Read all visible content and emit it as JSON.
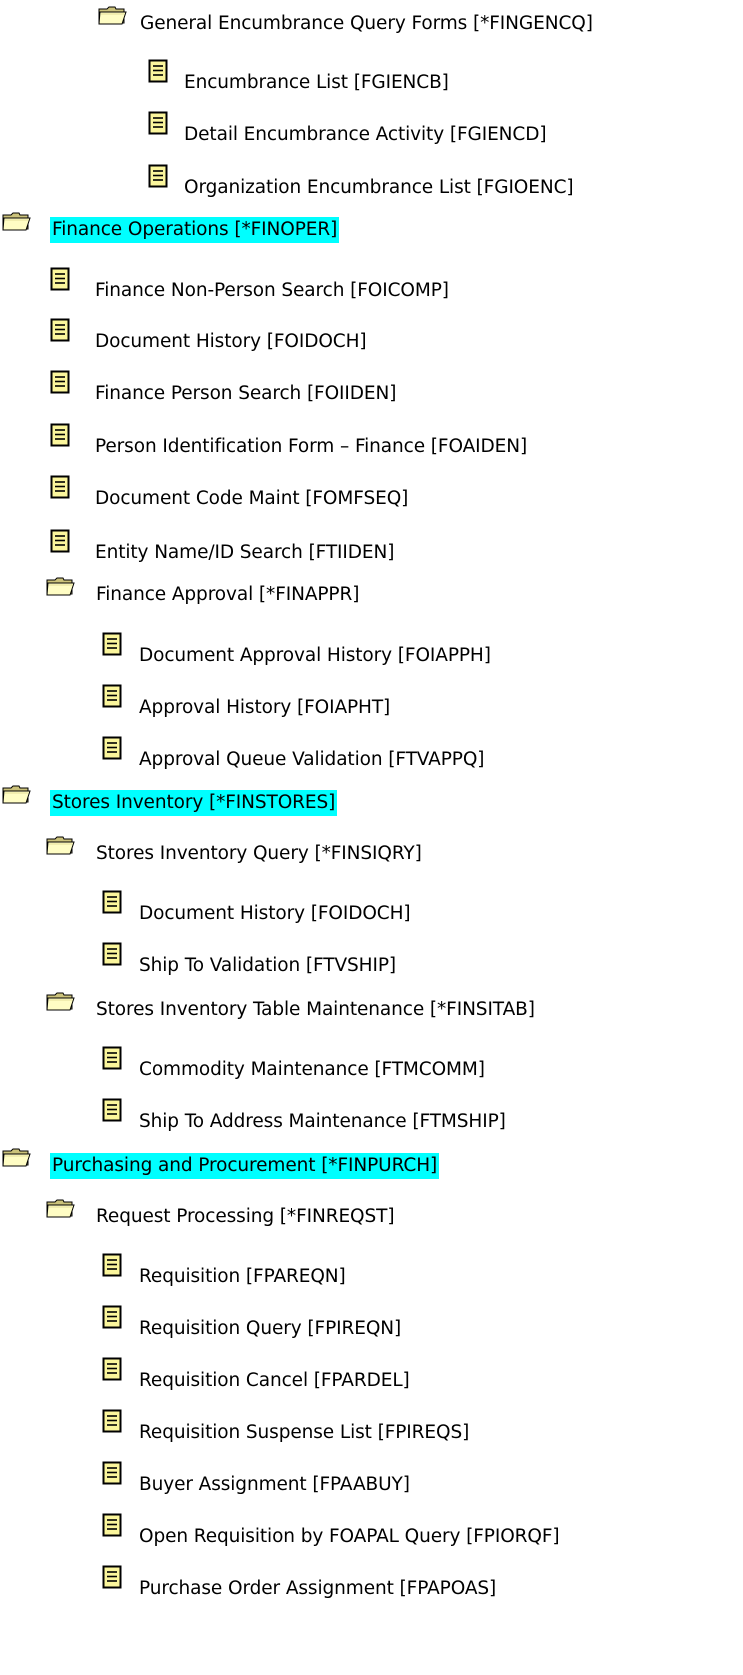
{
  "tree": {
    "highlight_color": "#00ffff",
    "items": [
      {
        "type": "folder",
        "icon": "open-folder-icon",
        "level": 2,
        "label": "General Encumbrance Query Forms [*FINGENCQ]"
      },
      {
        "type": "document",
        "icon": "document-icon",
        "level": 3,
        "label": "Encumbrance List [FGIENCB]"
      },
      {
        "type": "document",
        "icon": "document-icon",
        "level": 3,
        "label": "Detail Encumbrance Activity [FGIENCD]"
      },
      {
        "type": "document",
        "icon": "document-icon",
        "level": 3,
        "label": "Organization Encumbrance List [FGIOENC]"
      },
      {
        "type": "folder",
        "icon": "open-folder-icon",
        "level": 0,
        "highlight": true,
        "label": "Finance Operations [*FINOPER]"
      },
      {
        "type": "document",
        "icon": "document-icon",
        "level": 1,
        "label": "Finance Non-Person Search [FOICOMP]"
      },
      {
        "type": "document",
        "icon": "document-icon",
        "level": 1,
        "label": "Document History [FOIDOCH]"
      },
      {
        "type": "document",
        "icon": "document-icon",
        "level": 1,
        "label": "Finance Person Search [FOIIDEN]"
      },
      {
        "type": "document",
        "icon": "document-icon",
        "level": 1,
        "label": "Person Identification Form – Finance [FOAIDEN]"
      },
      {
        "type": "document",
        "icon": "document-icon",
        "level": 1,
        "label": "Document Code Maint [FOMFSEQ]"
      },
      {
        "type": "document",
        "icon": "document-icon",
        "level": 1,
        "label": "Entity Name/ID Search [FTIIDEN]"
      },
      {
        "type": "folder",
        "icon": "open-folder-icon",
        "level": 1,
        "label": "Finance Approval [*FINAPPR]"
      },
      {
        "type": "document",
        "icon": "document-icon",
        "level": 2,
        "label": "Document Approval History [FOIAPPH]"
      },
      {
        "type": "document",
        "icon": "document-icon",
        "level": 2,
        "label": "Approval History [FOIAPHT]"
      },
      {
        "type": "document",
        "icon": "document-icon",
        "level": 2,
        "label": "Approval Queue Validation [FTVAPPQ]"
      },
      {
        "type": "folder",
        "icon": "open-folder-icon",
        "level": 0,
        "highlight": true,
        "label": "Stores Inventory [*FINSTORES]"
      },
      {
        "type": "folder",
        "icon": "open-folder-icon",
        "level": 1,
        "label": "Stores Inventory Query [*FINSIQRY]"
      },
      {
        "type": "document",
        "icon": "document-icon",
        "level": 2,
        "label": "Document History [FOIDOCH]"
      },
      {
        "type": "document",
        "icon": "document-icon",
        "level": 2,
        "label": "Ship To Validation [FTVSHIP]"
      },
      {
        "type": "folder",
        "icon": "open-folder-icon",
        "level": 1,
        "label": "Stores Inventory Table Maintenance [*FINSITAB]"
      },
      {
        "type": "document",
        "icon": "document-icon",
        "level": 2,
        "label": "Commodity Maintenance [FTMCOMM]"
      },
      {
        "type": "document",
        "icon": "document-icon",
        "level": 2,
        "label": "Ship To Address Maintenance [FTMSHIP]"
      },
      {
        "type": "folder",
        "icon": "open-folder-icon",
        "level": 0,
        "highlight": true,
        "label": "Purchasing and Procurement [*FINPURCH]"
      },
      {
        "type": "folder",
        "icon": "open-folder-icon",
        "level": 1,
        "label": "Request Processing [*FINREQST]"
      },
      {
        "type": "document",
        "icon": "document-icon",
        "level": 2,
        "label": "Requisition [FPAREQN]"
      },
      {
        "type": "document",
        "icon": "document-icon",
        "level": 2,
        "label": "Requisition Query [FPIREQN]"
      },
      {
        "type": "document",
        "icon": "document-icon",
        "level": 2,
        "label": "Requisition Cancel [FPARDEL]"
      },
      {
        "type": "document",
        "icon": "document-icon",
        "level": 2,
        "label": "Requisition Suspense List [FPIREQS]"
      },
      {
        "type": "document",
        "icon": "document-icon",
        "level": 2,
        "label": "Buyer Assignment [FPAABUY]"
      },
      {
        "type": "document",
        "icon": "document-icon",
        "level": 2,
        "label": "Open Requisition by FOAPAL Query [FPIORQF]"
      },
      {
        "type": "document",
        "icon": "document-icon",
        "level": 2,
        "label": "Purchase Order Assignment [FPAPOAS]"
      }
    ]
  }
}
